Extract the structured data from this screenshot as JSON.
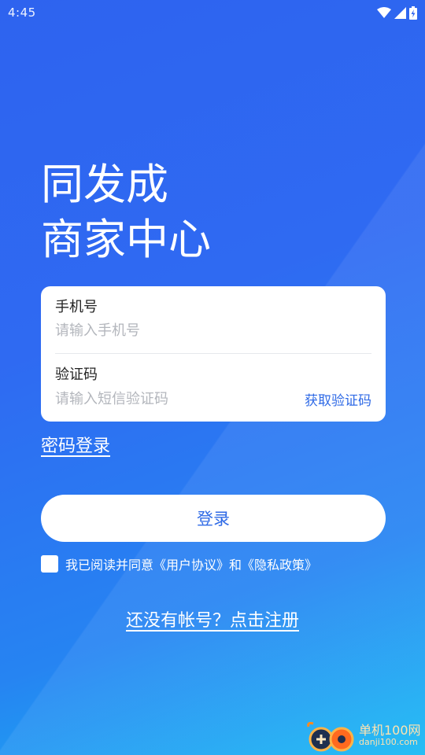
{
  "status_bar": {
    "time": "4:45"
  },
  "app_title": {
    "line1": "同发成",
    "line2": "商家中心"
  },
  "form": {
    "phone_label": "手机号",
    "phone_placeholder": "请输入手机号",
    "code_label": "验证码",
    "code_placeholder": "请输入短信验证码",
    "get_code_label": "获取验证码"
  },
  "password_login_label": "密码登录",
  "login_button_label": "登录",
  "agreement": {
    "text": "我已阅读并同意《用户协议》和《隐私政策》",
    "checked": false
  },
  "register_label": "还没有帐号？点击注册",
  "watermark": {
    "name": "单机100网",
    "url": "danji100.com"
  },
  "colors": {
    "accent": "#2f6ae6",
    "background_top": "#2e63ef",
    "background_bottom": "#16b9f3"
  }
}
